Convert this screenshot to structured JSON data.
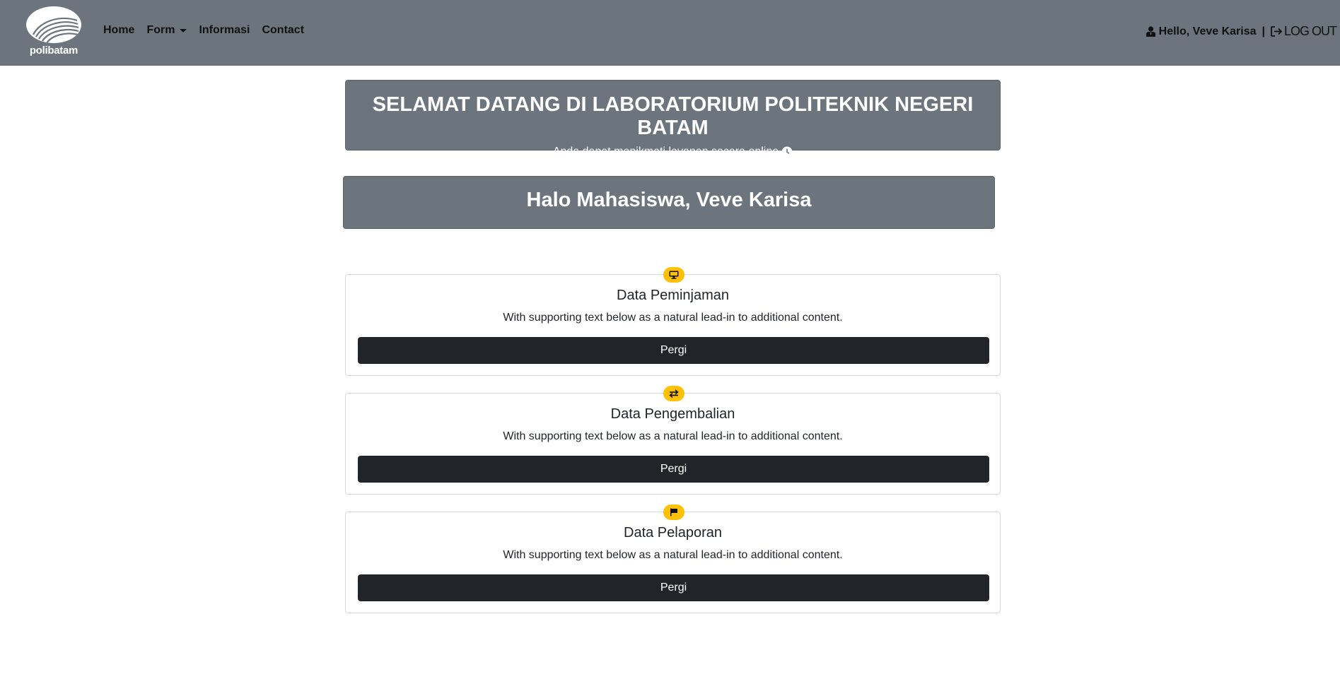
{
  "navbar": {
    "brand": "polibatam",
    "links": [
      {
        "label": "Home"
      },
      {
        "label": "Form"
      },
      {
        "label": "Informasi"
      },
      {
        "label": "Contact"
      }
    ],
    "greeting": "Hello, Veve Karisa",
    "separator": "|",
    "logout_label": "LOG OUT",
    "background": "#6c757d"
  },
  "hero": {
    "title": "SELAMAT DATANG DI LABORATORIUM POLITEKNIK NEGERI BATAM",
    "subtitle": "Anda dapat menikmati layanan secara online"
  },
  "greeting": {
    "text": "Halo Mahasiswa, Veve Karisa"
  },
  "cards": [
    {
      "icon": "computer-icon",
      "title": "Data Peminjaman",
      "text": "With supporting text below as a natural lead-in to additional content.",
      "button": "Pergi"
    },
    {
      "icon": "arrows-exchange-icon",
      "title": "Data Pengembalian",
      "text": "With supporting text below as a natural lead-in to additional content.",
      "button": "Pergi"
    },
    {
      "icon": "flag-icon",
      "title": "Data Pelaporan",
      "text": "With supporting text below as a natural lead-in to additional content.",
      "button": "Pergi"
    }
  ],
  "colors": {
    "badge": "#ffc107",
    "button": "#212529",
    "panel": "#6c757d"
  }
}
